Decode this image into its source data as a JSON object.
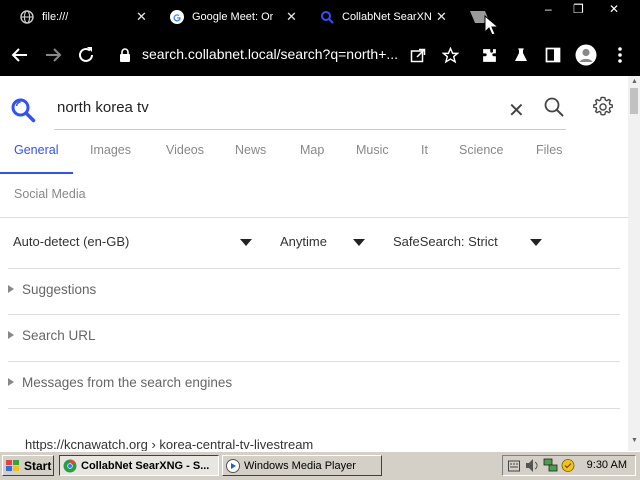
{
  "browser": {
    "tabs": [
      {
        "title": "file:///",
        "icon": "globe-icon"
      },
      {
        "title": "Google Meet: Or",
        "icon": "google-icon"
      },
      {
        "title": "CollabNet SearXN",
        "icon": "searxng-icon",
        "active": true
      }
    ],
    "address": "search.collabnet.local/search?q=north+..."
  },
  "search": {
    "query": "north korea tv",
    "categories": [
      "General",
      "Images",
      "Videos",
      "News",
      "Map",
      "Music",
      "It",
      "Science",
      "Files",
      "Social Media"
    ],
    "active_category": "General"
  },
  "filters": {
    "language": "Auto-detect (en-GB)",
    "time": "Anytime",
    "safesearch": "SafeSearch: Strict"
  },
  "sections": [
    "Suggestions",
    "Search URL",
    "Messages from the search engines"
  ],
  "result": {
    "url": "https://kcnawatch.org › korea-central-tv-livestream"
  },
  "taskbar": {
    "start": "Start",
    "tasks": [
      "CollabNet SearXNG - S...",
      "Windows Media Player"
    ],
    "clock": "9:30 AM"
  },
  "colors": {
    "accent": "#3050ff",
    "chrome_bg": "#000000",
    "taskbar_bg": "#d4d0c8"
  }
}
